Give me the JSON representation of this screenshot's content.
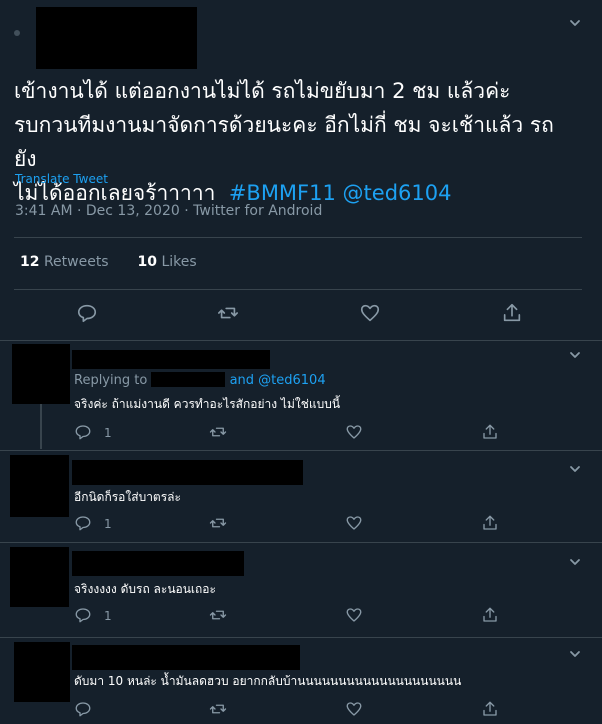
{
  "tweet": {
    "text_lines": [
      "เข้างานได้ แต่ออกงานไม่ได้ รถไม่ขยับมา 2 ชม แล้วค่ะ",
      "รบกวนทีมงานมาจัดการด้วยนะคะ อีกไม่กี่ ชม จะเช้าแล้ว รถยัง",
      "ไม่ได้ออกเลยจร้าาาาา"
    ],
    "hashtags": [
      "#BMMF11",
      "@ted6104"
    ],
    "translate": "Translate Tweet",
    "meta": "3:41 AM · Dec 13, 2020 · Twitter for Android",
    "retweets_count": "12",
    "retweets_label": "Retweets",
    "likes_count": "10",
    "likes_label": "Likes"
  },
  "replies": [
    {
      "replying_prefix": "Replying to",
      "replying_suffix": "and @ted6104",
      "text": "จริงค่ะ ถ้าแม่งานดี ควรทำอะไรสักอย่าง ไม่ใช่แบบนี้",
      "reply_count": "1"
    },
    {
      "text": "อีกนิดก็รอใส่บาตรล่ะ",
      "reply_count": "1"
    },
    {
      "text": "จริงงงงง ดับรถ ละนอนเถอะ",
      "reply_count": "1"
    },
    {
      "text": "ดับมา 10 หนล่ะ น้ำมันลดฮวบ อยากกลับบ้านนนนนนนนนนนนนนนนนนนน",
      "reply_count": ""
    }
  ],
  "icons": [
    "chevron-down-icon",
    "reply-icon",
    "retweet-icon",
    "like-icon",
    "share-icon"
  ],
  "colors": {
    "background": "#15202b",
    "accent": "#1da1f2",
    "muted": "#8899a6",
    "divider": "#38444d"
  }
}
